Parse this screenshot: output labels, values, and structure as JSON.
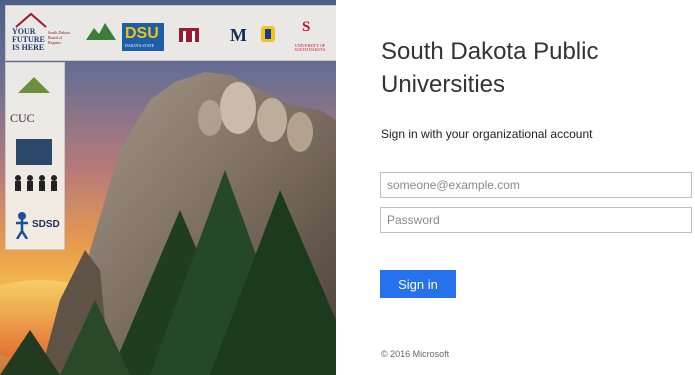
{
  "left_panel": {
    "logos": {
      "your_future": "YOUR FUTURE IS HERE",
      "board": "South Dakota Board of Regents",
      "dsu": "DSU",
      "dsu_sub": "DAKOTA STATE",
      "sdsmt": "M",
      "usd_mark": "S",
      "usd_sub": "UNIVERSITY OF SOUTH DAKOTA",
      "cuc": "CUC",
      "sdsd": "SDSD"
    },
    "colors": {
      "dsu_blue": "#1c5ea8",
      "dsu_gold": "#f4c20d",
      "usd_red": "#c8102e"
    }
  },
  "signin": {
    "title": "South Dakota Public Universities",
    "subtitle": "Sign in with your organizational account",
    "username_placeholder": "someone@example.com",
    "password_placeholder": "Password",
    "button_label": "Sign in",
    "button_color": "#2672ec"
  },
  "footer": {
    "copyright": "© 2016 Microsoft"
  }
}
